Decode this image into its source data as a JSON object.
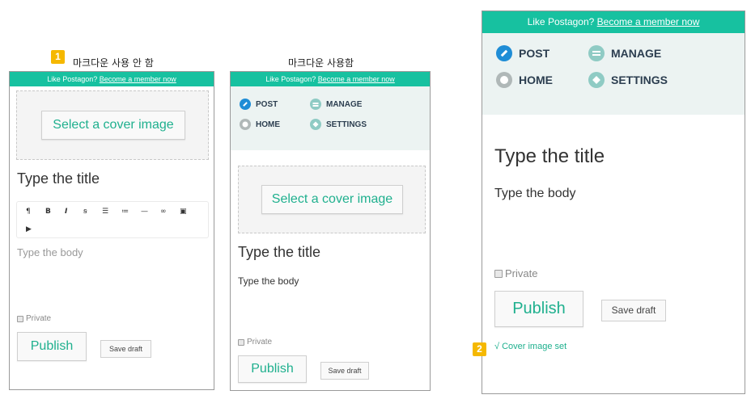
{
  "captions": {
    "no_markdown": "마크다운 사용 안 함",
    "markdown": "마크다운 사용함"
  },
  "markers": {
    "one": "1",
    "two": "2"
  },
  "banner": {
    "prefix": "Like Postagon?",
    "link": "Become a member now"
  },
  "menu": {
    "post": "POST",
    "manage": "MANAGE",
    "home": "HOME",
    "settings": "SETTINGS"
  },
  "editor": {
    "cover_button": "Select a cover image",
    "title_placeholder": "Type the title",
    "body_placeholder": "Type the body",
    "private_label": "Private",
    "publish_label": "Publish",
    "save_draft_label": "Save draft",
    "cover_set": "√ Cover image set"
  },
  "toolbar_icons": [
    "paragraph-icon",
    "bold-icon",
    "italic-icon",
    "strikethrough-icon",
    "unordered-list-icon",
    "ordered-list-icon",
    "horizontal-rule-icon",
    "link-icon",
    "image-icon",
    "video-icon"
  ],
  "colors": {
    "brand": "#17c1a0",
    "accent_text": "#1fb08e",
    "menu_bg": "#ecf3f2",
    "post_icon": "#1f8dd6"
  }
}
